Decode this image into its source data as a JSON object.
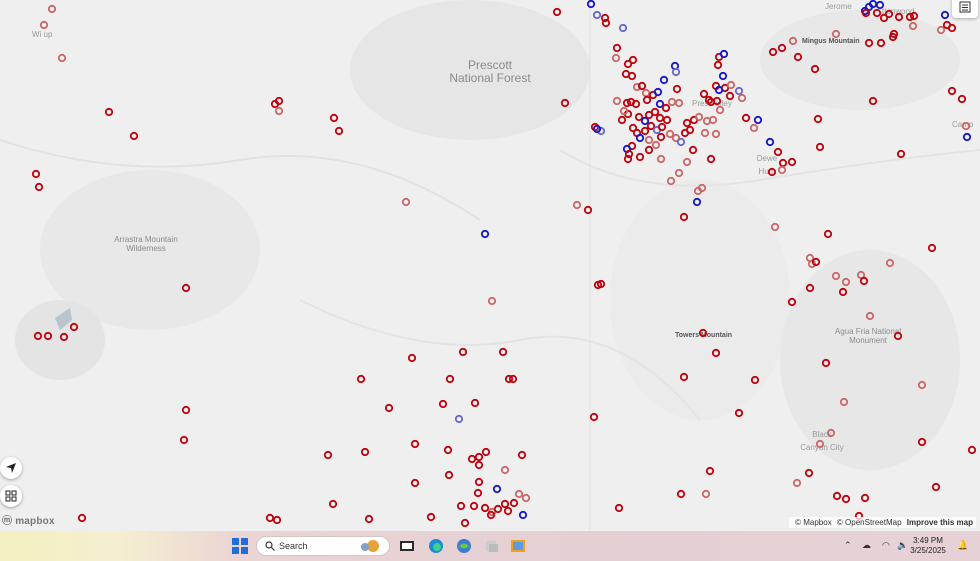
{
  "map": {
    "place_labels": {
      "prescott_nf_line1": "Prescott",
      "prescott_nf_line2": "National Forest",
      "arrastra_line1": "Arrastra Mountain",
      "arrastra_line2": "Wilderness",
      "mingus": "Mingus Mountain",
      "towers": "Towers Mountain",
      "agua_fria_line1": "Agua Fria National",
      "agua_fria_line2": "Monument",
      "black_canyon_line1": "Black",
      "black_canyon_line2": "Canyon City",
      "dewey_line1": "Dewe",
      "dewey_line2": "Hum",
      "cottonwood": "ttonwood",
      "jerome": "Jerome",
      "prescott_valley": "Pres    Valley",
      "yarnell": "Wi    up",
      "camp_verde": "Camp"
    },
    "colors": {
      "red_marker": "#c0000b",
      "light_red_marker": "#cc6666",
      "blue_marker": "#1414c8",
      "light_blue_marker": "#6666cc"
    },
    "markers": [
      {
        "lat": 0.0,
        "c": "r"
      }
    ],
    "logo_text": "mapbox",
    "attribution": {
      "mapbox": "© Mapbox",
      "osm": "© OpenStreetMap",
      "improve": "Improve this map"
    }
  },
  "taskbar": {
    "search_placeholder": "Search",
    "time": "3:49 PM",
    "date": "3/25/2025"
  }
}
